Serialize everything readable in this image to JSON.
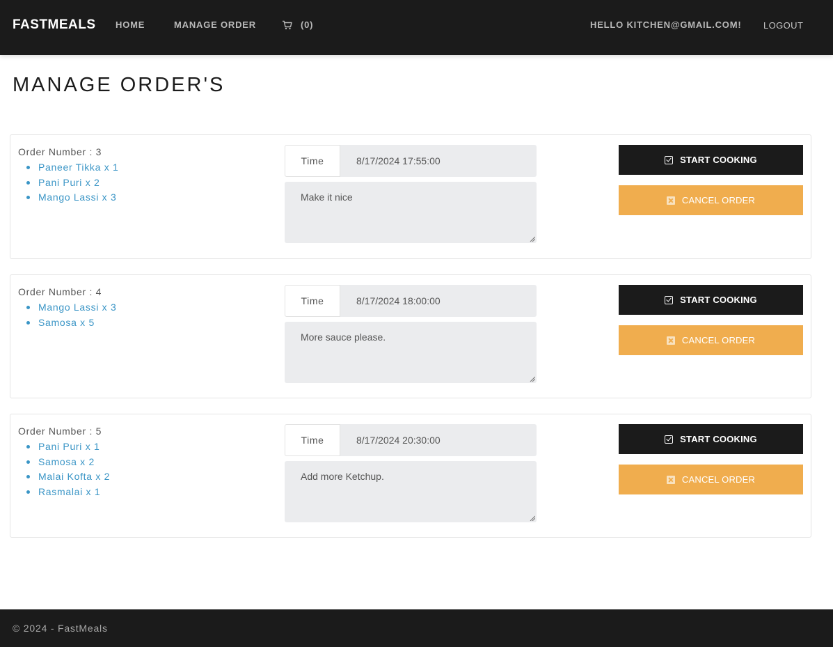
{
  "navbar": {
    "brand": "FASTMEALS",
    "home": "HOME",
    "manage_order": "MANAGE ORDER",
    "cart_count": "(0)",
    "hello": "HELLO KITCHEN@GMAIL.COM!",
    "logout": "LOGOUT"
  },
  "page": {
    "title": "MANAGE ORDER'S"
  },
  "orders": [
    {
      "heading": "Order Number : 3",
      "items": [
        "Paneer Tikka x 1",
        "Pani Puri x 2",
        "Mango Lassi x 3"
      ],
      "time_label": "Time",
      "time_value": "8/17/2024 17:55:00",
      "notes": "Make it nice",
      "start_label": "START COOKING",
      "cancel_label": "CANCEL ORDER"
    },
    {
      "heading": "Order Number : 4",
      "items": [
        "Mango Lassi x 3",
        "Samosa x 5"
      ],
      "time_label": "Time",
      "time_value": "8/17/2024 18:00:00",
      "notes": "More sauce please.",
      "start_label": "START COOKING",
      "cancel_label": "CANCEL ORDER"
    },
    {
      "heading": "Order Number : 5",
      "items": [
        "Pani Puri x 1",
        "Samosa x 2",
        "Malai Kofta x 2",
        "Rasmalai x 1"
      ],
      "time_label": "Time",
      "time_value": "8/17/2024 20:30:00",
      "notes": "Add more Ketchup.",
      "start_label": "START COOKING",
      "cancel_label": "CANCEL ORDER"
    }
  ],
  "footer": {
    "text": "© 2024 - FastMeals"
  },
  "colors": {
    "navbar_bg": "#1b1b1b",
    "link": "#3a95c6",
    "cancel": "#f0ad4e",
    "field_bg": "#ebecee"
  }
}
